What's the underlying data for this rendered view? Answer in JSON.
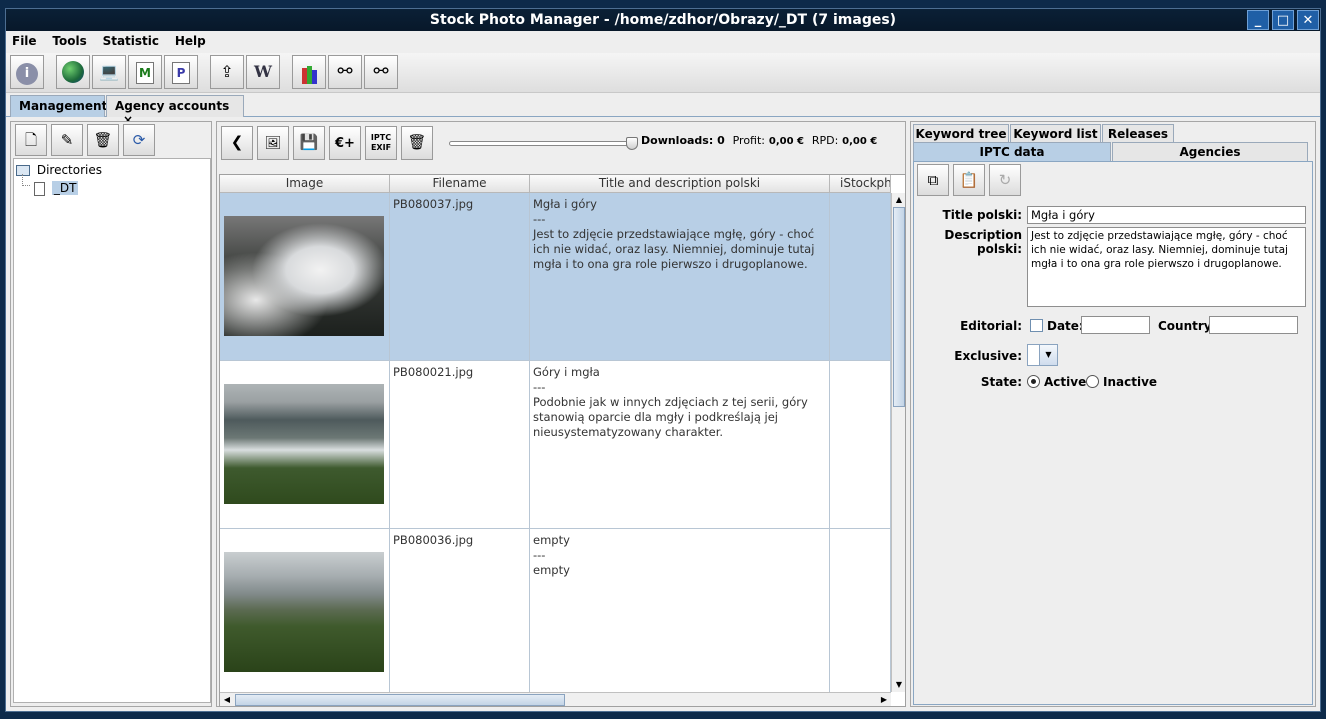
{
  "window": {
    "title": "Stock Photo Manager - /home/zdhor/Obrazy/_DT (7 images)",
    "controls": {
      "minimize": "_",
      "maximize": "□",
      "close": "✕"
    }
  },
  "menu": [
    "File",
    "Tools",
    "Statistic",
    "Help"
  ],
  "main_tabs": [
    {
      "label": "Management",
      "selected": true
    },
    {
      "label": "Agency accounts",
      "close": "×"
    }
  ],
  "tree": {
    "root": "Directories",
    "child": "_DT"
  },
  "center_toolbar": {
    "iptc_exif_label_1": "IPTC",
    "iptc_exif_label_2": "EXIF",
    "euro_label": "€+",
    "downloads_label": "Downloads:",
    "downloads_value": "0",
    "profit_label": "Profit:",
    "profit_value": "0,00 €",
    "rpd_label": "RPD:",
    "rpd_value": "0,00 €"
  },
  "table": {
    "columns": [
      "Image",
      "Filename",
      "Title and description polski",
      "iStockpho"
    ],
    "rows": [
      {
        "filename": "PB080037.jpg",
        "title": "Mgła i góry",
        "sep": "---",
        "desc": "Jest to zdjęcie przedstawiające mgłę, góry - choć ich nie widać, oraz lasy. Niemniej, dominuje tutaj mgła i to ona gra role pierwszo i drugoplanowe."
      },
      {
        "filename": "PB080021.jpg",
        "title": "Góry i mgła",
        "sep": "---",
        "desc": "Podobnie jak w innych zdjęciach z tej serii, góry stanowią oparcie dla mgły i podkreślają jej nieusystematyzowany charakter."
      },
      {
        "filename": "PB080036.jpg",
        "title": "empty",
        "sep": "---",
        "desc": "empty"
      }
    ]
  },
  "right_panel": {
    "tabs_row1": [
      "Keyword tree",
      "Keyword list",
      "Releases"
    ],
    "tabs_row2": [
      "IPTC data",
      "Agencies"
    ],
    "title_label": "Title polski:",
    "title_value": "Mgła i góry",
    "desc_label": "Description polski:",
    "desc_value": "Jest to zdjęcie przedstawiające mgłę, góry - choć ich nie widać, oraz lasy. Niemniej, dominuje tutaj mgła i to ona gra role pierwszo i drugoplanowe.",
    "editorial_label": "Editorial:",
    "date_label": "Date:",
    "country_label": "Country:",
    "exclusive_label": "Exclusive:",
    "state_label": "State:",
    "state_active": "Active",
    "state_inactive": "Inactive"
  },
  "colors": {
    "selection": "#b8cfe6",
    "titlebar": "#0a2036",
    "tab_selected": "#b8cfe5"
  }
}
